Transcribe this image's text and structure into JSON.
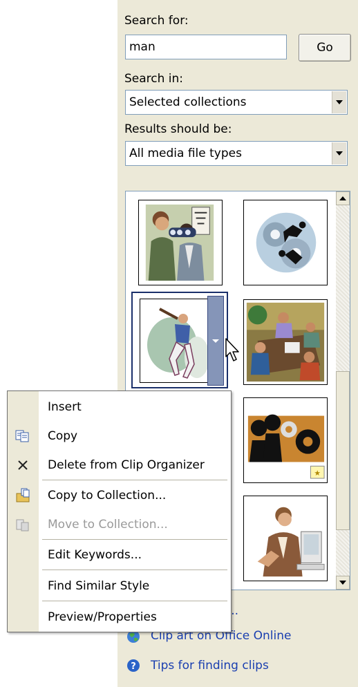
{
  "search": {
    "label": "Search for:",
    "value": "man",
    "go_label": "Go"
  },
  "search_in": {
    "label": "Search in:",
    "selected": "Selected collections"
  },
  "results_type": {
    "label": "Results should be:",
    "selected": "All media file types"
  },
  "links": {
    "organize_partial": "s...",
    "clip_art_online": "Clip art on Office Online",
    "tips": "Tips for finding clips"
  },
  "menu": {
    "insert": "Insert",
    "copy": "Copy",
    "delete": "Delete from Clip Organizer",
    "copy_to_collection": "Copy to Collection...",
    "move_to_collection": "Move to Collection...",
    "edit_keywords": "Edit Keywords...",
    "find_similar_style": "Find Similar Style",
    "preview_properties": "Preview/Properties"
  },
  "colors": {
    "pane_bg": "#ece9d8",
    "link": "#1a3fb0",
    "selection_border": "#1a2f6a",
    "disabled_text": "#9a9a9a"
  }
}
